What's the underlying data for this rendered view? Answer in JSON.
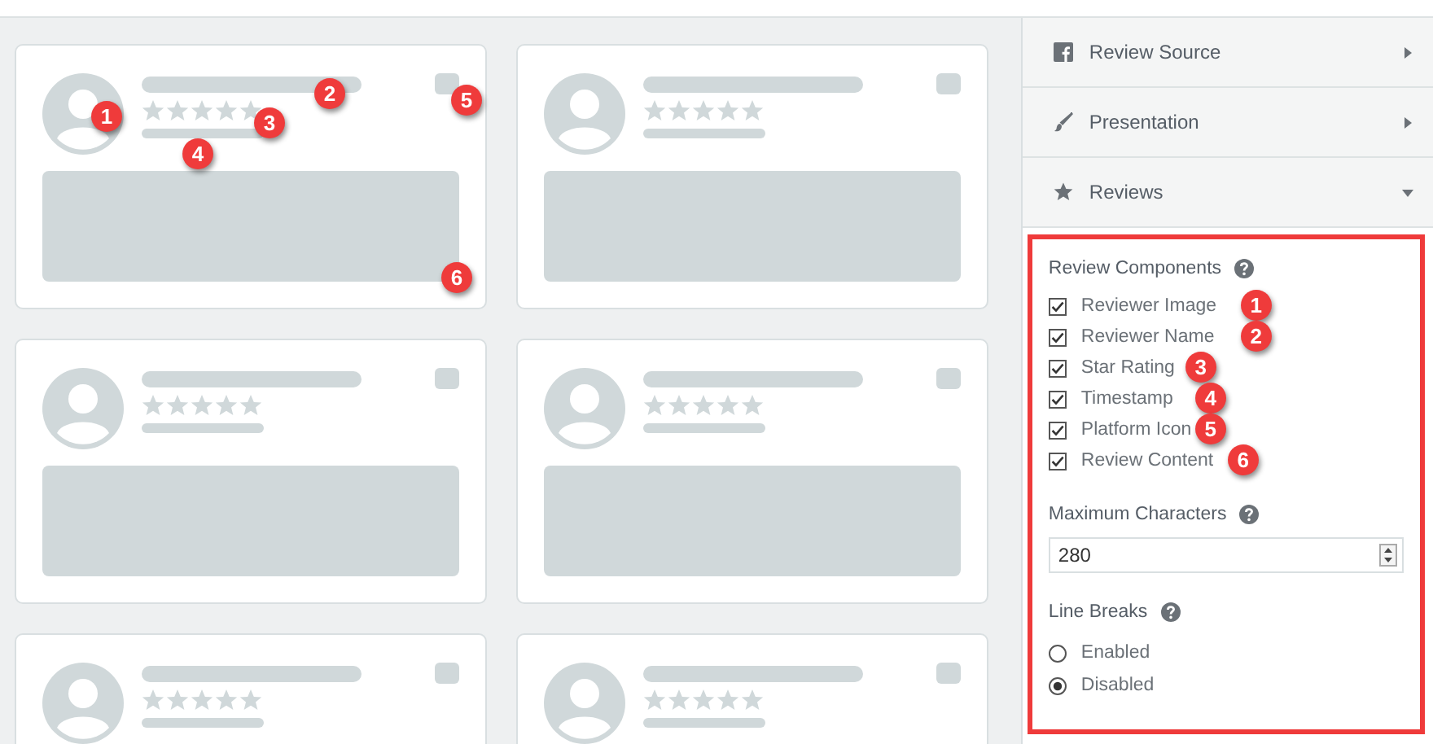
{
  "cards": [
    {
      "kind": "preview",
      "markers": [
        "1",
        "2",
        "3",
        "4",
        "5",
        "6"
      ]
    },
    {
      "kind": "preview"
    },
    {
      "kind": "preview"
    },
    {
      "kind": "preview"
    },
    {
      "kind": "header"
    },
    {
      "kind": "header"
    }
  ],
  "sidebar": {
    "sections": [
      {
        "label": "Review Source",
        "expanded": false
      },
      {
        "label": "Presentation",
        "expanded": false
      },
      {
        "label": "Reviews",
        "expanded": true
      }
    ],
    "components": {
      "title": "Review Components",
      "items": [
        {
          "label": "Reviewer Image",
          "checked": true,
          "marker": "1"
        },
        {
          "label": "Reviewer Name",
          "checked": true,
          "marker": "2"
        },
        {
          "label": "Star Rating",
          "checked": true,
          "marker": "3"
        },
        {
          "label": "Timestamp",
          "checked": true,
          "marker": "4"
        },
        {
          "label": "Platform Icon",
          "checked": true,
          "marker": "5"
        },
        {
          "label": "Review Content",
          "checked": true,
          "marker": "6"
        }
      ]
    },
    "max_characters": {
      "label": "Maximum Characters",
      "value": "280"
    },
    "line_breaks": {
      "label": "Line Breaks",
      "options": [
        {
          "label": "Enabled",
          "selected": false
        },
        {
          "label": "Disabled",
          "selected": true
        }
      ]
    }
  }
}
